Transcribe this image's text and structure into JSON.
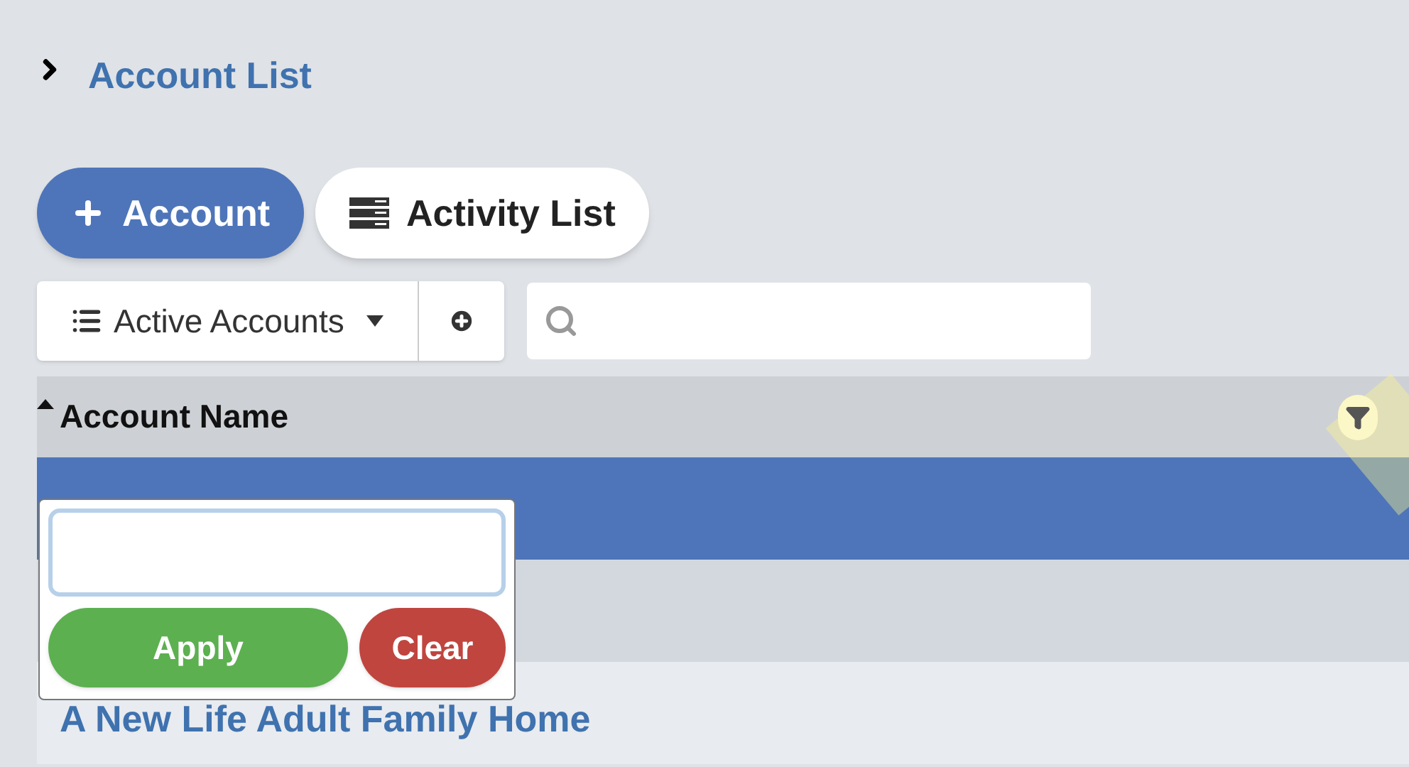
{
  "breadcrumb": {
    "title": "Account List"
  },
  "actions": [
    {
      "kind": "primary",
      "label": "Account"
    },
    {
      "kind": "secondary",
      "label": "Activity List"
    }
  ],
  "view_selector": {
    "label": "Active Accounts"
  },
  "table": {
    "columns": [
      {
        "label": "Account Name",
        "sorted": true,
        "filter_highlighted": true
      }
    ],
    "rows": [
      {
        "selected": true
      },
      {
        "selected": false,
        "kind": "dark"
      },
      {
        "selected": false,
        "kind": "light",
        "name": "A New Life Adult Family Home"
      }
    ]
  },
  "filter_popup": {
    "open": true,
    "apply_label": "Apply",
    "clear_label": "Clear"
  }
}
